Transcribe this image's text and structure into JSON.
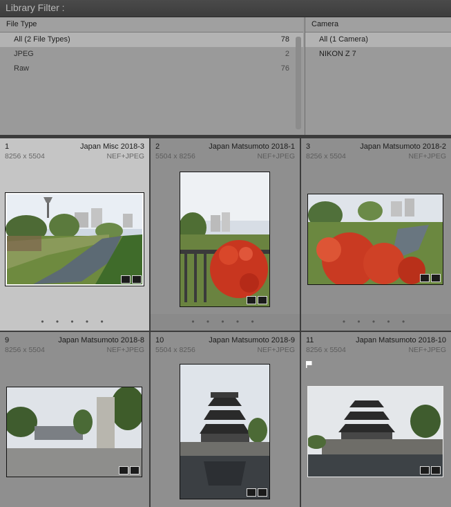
{
  "titlebar": {
    "label": "Library Filter :"
  },
  "filter": {
    "file_type": {
      "header": "File Type",
      "rows": [
        {
          "label": "All (2 File Types)",
          "count": "78"
        },
        {
          "label": "JPEG",
          "count": "2"
        },
        {
          "label": "Raw",
          "count": "76"
        }
      ]
    },
    "camera": {
      "header": "Camera",
      "rows": [
        {
          "label": "All (1 Camera)"
        },
        {
          "label": "NIKON Z 7"
        }
      ]
    }
  },
  "grid": {
    "cells": [
      {
        "num": "1",
        "name": "Japan Misc 2018-3",
        "dims": "8256 x 5504",
        "ftype": "NEF+JPEG",
        "dots": "• • • • •"
      },
      {
        "num": "2",
        "name": "Japan Matsumoto 2018-1",
        "dims": "5504 x 8256",
        "ftype": "NEF+JPEG",
        "dots": "• • • • •"
      },
      {
        "num": "3",
        "name": "Japan Matsumoto 2018-2",
        "dims": "8256 x 5504",
        "ftype": "NEF+JPEG",
        "dots": "• • • • •"
      },
      {
        "num": "9",
        "name": "Japan Matsumoto 2018-8",
        "dims": "8256 x 5504",
        "ftype": "NEF+JPEG"
      },
      {
        "num": "10",
        "name": "Japan Matsumoto 2018-9",
        "dims": "5504 x 8256",
        "ftype": "NEF+JPEG"
      },
      {
        "num": "11",
        "name": "Japan Matsumoto 2018-10",
        "dims": "8256 x 5504",
        "ftype": "NEF+JPEG"
      }
    ]
  }
}
